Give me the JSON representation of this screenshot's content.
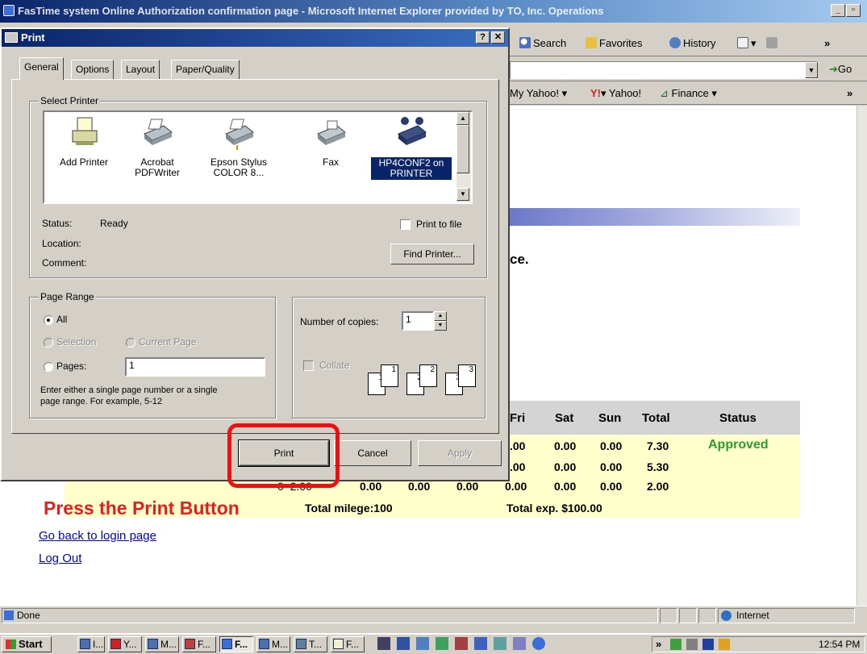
{
  "ie": {
    "title": "FasTime system Online Authorization confirmation page - Microsoft Internet Explorer provided by TO, Inc. Operations",
    "toolbar": {
      "search": "Search",
      "favorites": "Favorites",
      "history": "History"
    },
    "address_go": "Go",
    "links": {
      "my_yahoo": "My Yahoo!",
      "yahoo": "Yahoo!",
      "finance": "Finance"
    },
    "status": "Done",
    "zone": "Internet"
  },
  "page": {
    "partial_text": "ce.",
    "table": {
      "headers": [
        "Fri",
        "Sat",
        "Sun",
        "Total",
        "Status"
      ],
      "rows": [
        {
          "fri": ".00",
          "sat": "0.00",
          "sun": "0.00",
          "total": "7.30",
          "status": "Approved"
        },
        {
          "fri": ".00",
          "sat": "0.00",
          "sun": "0.00",
          "total": "5.30",
          "status": ""
        },
        {
          "left": "0  2.00",
          "c1": "0.00",
          "c2": "0.00",
          "c3": "0.00",
          "fri": "0.00",
          "sat": "0.00",
          "sun": "0.00",
          "total": "2.00"
        }
      ],
      "total_milege": "Total milege:100",
      "total_exp": "Total exp. $100.00"
    },
    "annotation": "Press the Print Button",
    "links": [
      "Go back to login page",
      "Log Out"
    ]
  },
  "dialog": {
    "title": "Print",
    "tabs": [
      "General",
      "Options",
      "Layout",
      "Paper/Quality"
    ],
    "select_printer_label": "Select Printer",
    "printers": [
      {
        "name": "Add Printer",
        "icon": "add-printer-icon"
      },
      {
        "name": "Acrobat PDFWriter",
        "icon": "printer-icon"
      },
      {
        "name": "Epson Stylus COLOR 8...",
        "icon": "printer-icon"
      },
      {
        "name": "Fax",
        "icon": "fax-icon"
      },
      {
        "name": "HP4CONF2 on PRINTER",
        "icon": "network-printer-icon",
        "selected": true
      }
    ],
    "status_label": "Status:",
    "status_value": "Ready",
    "location_label": "Location:",
    "comment_label": "Comment:",
    "print_to_file": "Print to file",
    "find_printer": "Find Printer...",
    "page_range_label": "Page Range",
    "range_all": "All",
    "range_selection": "Selection",
    "range_current": "Current Page",
    "range_pages": "Pages:",
    "pages_value": "1",
    "range_hint_1": "Enter either a single page number or a single",
    "range_hint_2": "page range.  For example, 5-12",
    "copies_label": "Number of copies:",
    "copies_value": "1",
    "collate": "Collate",
    "print_btn": "Print",
    "cancel_btn": "Cancel",
    "apply_btn": "Apply"
  },
  "taskbar": {
    "start": "Start",
    "tasks": [
      "I...",
      "Y...",
      "M...",
      "F...",
      "F...",
      "M...",
      "T...",
      "F..."
    ],
    "clock": "12:54 PM"
  }
}
